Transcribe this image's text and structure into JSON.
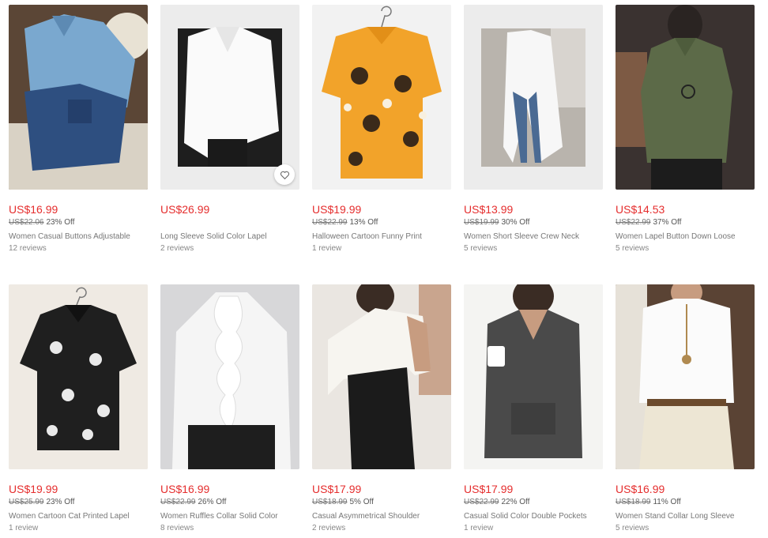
{
  "products": [
    {
      "price": "US$16.99",
      "original_price": "US$22.06",
      "discount": "23% Off",
      "title": "Women Casual Buttons Adjustable",
      "reviews": "12 reviews",
      "image": "denim-shirt"
    },
    {
      "price": "US$26.99",
      "original_price": "",
      "discount": "",
      "title": "Long Sleeve Solid Color Lapel",
      "reviews": "2 reviews",
      "image": "white-oversized-shirt",
      "wishlist_icon": "heart-icon"
    },
    {
      "price": "US$19.99",
      "original_price": "US$22.99",
      "discount": "13% Off",
      "title": "Halloween Cartoon Funny Print",
      "reviews": "1 review",
      "image": "halloween-print-shirt"
    },
    {
      "price": "US$13.99",
      "original_price": "US$19.99",
      "discount": "30% Off",
      "title": "Women Short Sleeve Crew Neck",
      "reviews": "5 reviews",
      "image": "white-split-tunic"
    },
    {
      "price": "US$14.53",
      "original_price": "US$22.99",
      "discount": "37% Off",
      "title": "Women Lapel Button Down Loose",
      "reviews": "5 reviews",
      "image": "green-linen-top"
    },
    {
      "price": "US$19.99",
      "original_price": "US$25.99",
      "discount": "23% Off",
      "title": "Women Cartoon Cat Printed Lapel",
      "reviews": "1 review",
      "image": "black-cat-print-shirt"
    },
    {
      "price": "US$16.99",
      "original_price": "US$22.99",
      "discount": "26% Off",
      "title": "Women Ruffles Collar Solid Color",
      "reviews": "8 reviews",
      "image": "white-ruffle-blouse"
    },
    {
      "price": "US$17.99",
      "original_price": "US$18.99",
      "discount": "5% Off",
      "title": "Casual Asymmetrical Shoulder",
      "reviews": "2 reviews",
      "image": "white-one-shoulder-blouse"
    },
    {
      "price": "US$17.99",
      "original_price": "US$22.99",
      "discount": "22% Off",
      "title": "Casual Solid Color Double Pockets",
      "reviews": "1 review",
      "image": "grey-long-tunic"
    },
    {
      "price": "US$16.99",
      "original_price": "US$18.99",
      "discount": "11% Off",
      "title": "Women Stand Collar Long Sleeve",
      "reviews": "5 reviews",
      "image": "white-stand-collar-top"
    }
  ],
  "colors": {
    "price": "#e52e2e",
    "text_muted": "#777777"
  }
}
